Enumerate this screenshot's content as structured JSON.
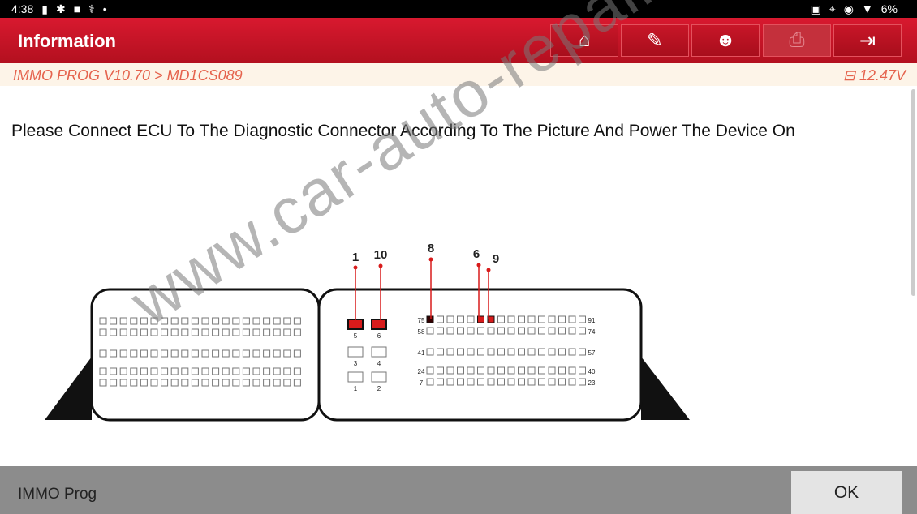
{
  "status_bar": {
    "time": "4:38",
    "battery": "6%",
    "left_icons": [
      "battery-icon",
      "gear-icon",
      "video-icon",
      "stethoscope-icon",
      "dot-icon"
    ],
    "right_icons": [
      "cast-icon",
      "location-icon",
      "vibrate-icon",
      "wifi-icon",
      "battery-icon"
    ]
  },
  "header": {
    "title": "Information",
    "buttons": [
      {
        "name": "home",
        "icon": "home-icon"
      },
      {
        "name": "report",
        "icon": "edit-icon"
      },
      {
        "name": "support",
        "icon": "user-icon"
      },
      {
        "name": "print",
        "icon": "printer-icon",
        "disabled": true
      },
      {
        "name": "exit",
        "icon": "exit-icon"
      }
    ]
  },
  "breadcrumb": {
    "path": "IMMO PROG V10.70 > MD1CS089",
    "voltage": "12.47V"
  },
  "message": "Please Connect ECU To The Diagnostic Connector According To The Picture And Power The Device On",
  "diagram": {
    "callouts": [
      "1",
      "10",
      "8",
      "6",
      "9"
    ],
    "right_row_labels": [
      [
        "75",
        "91"
      ],
      [
        "58",
        "74"
      ],
      [
        "41",
        "57"
      ],
      [
        "24",
        "40"
      ],
      [
        "7",
        "23"
      ]
    ],
    "power_pins": [
      "5",
      "6",
      "3",
      "4",
      "1",
      "2"
    ],
    "highlight_color": "#d81b1b"
  },
  "watermark": "www.car-auto-repair.com",
  "footer": {
    "label": "IMMO Prog",
    "ok": "OK"
  }
}
